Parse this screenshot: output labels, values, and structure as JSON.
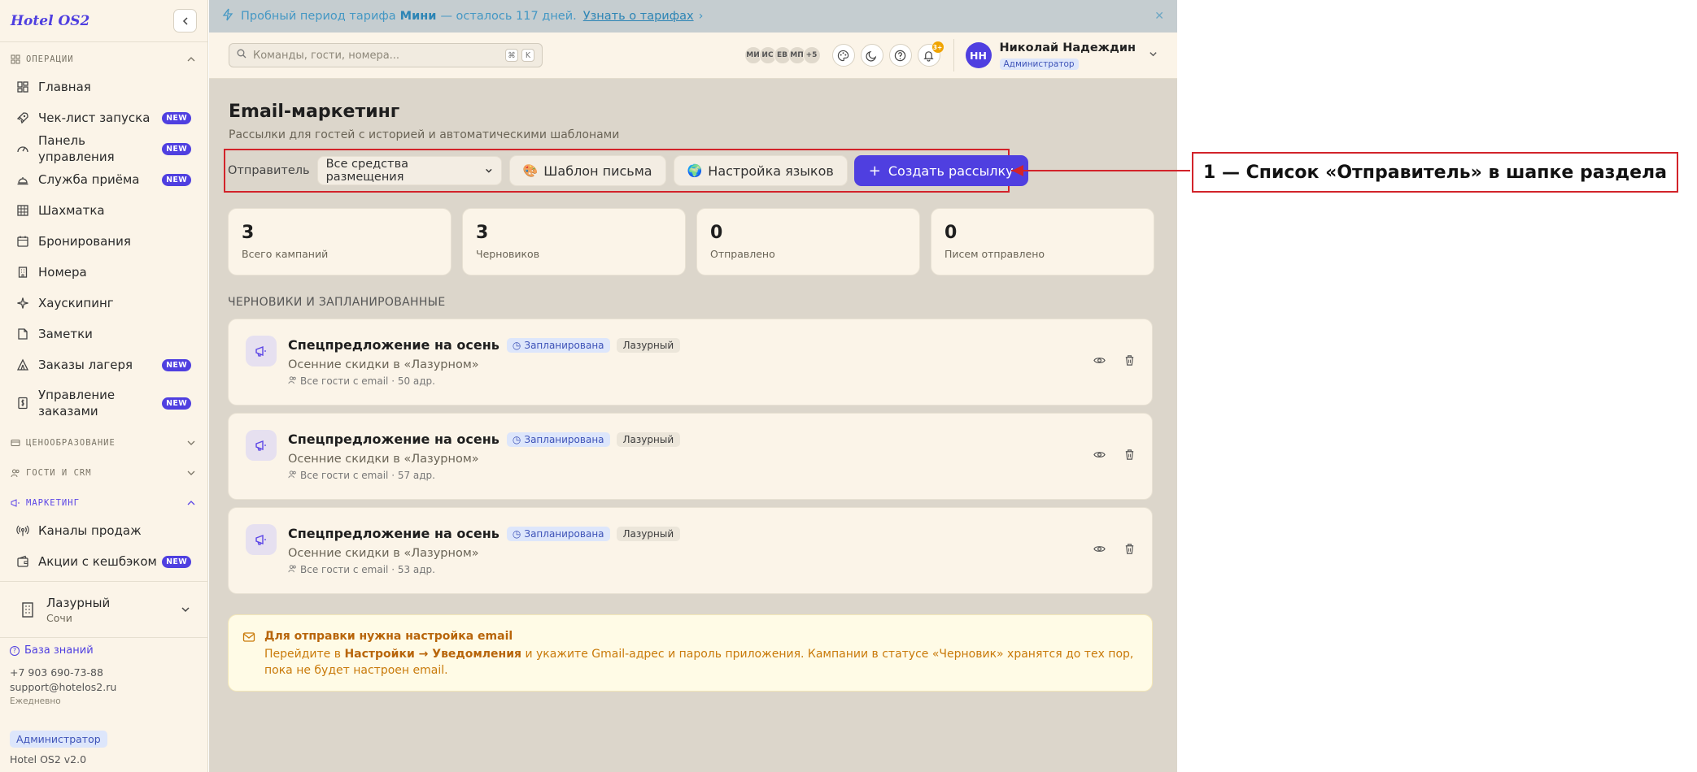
{
  "sidebar": {
    "logo": "Hotel OS2",
    "sections": {
      "operations": "ОПЕРАЦИИ",
      "pricing": "ЦЕНООБРАЗОВАНИЕ",
      "guests": "ГОСТИ И CRM",
      "marketing": "МАРКЕТИНГ"
    },
    "items": [
      {
        "label": "Главная",
        "icon": "dashboard-icon",
        "new": false
      },
      {
        "label": "Чек-лист запуска",
        "icon": "rocket-icon",
        "new": true
      },
      {
        "label": "Панель управления",
        "icon": "gauge-icon",
        "new": true
      },
      {
        "label": "Служба приёма",
        "icon": "bell-desk-icon",
        "new": true
      },
      {
        "label": "Шахматка",
        "icon": "grid-icon",
        "new": false
      },
      {
        "label": "Бронирования",
        "icon": "calendar-icon",
        "new": false
      },
      {
        "label": "Номера",
        "icon": "building-icon",
        "new": false
      },
      {
        "label": "Хаускипинг",
        "icon": "sparkle-icon",
        "new": false
      },
      {
        "label": "Заметки",
        "icon": "note-icon",
        "new": false
      },
      {
        "label": "Заказы лагеря",
        "icon": "tent-icon",
        "new": true
      },
      {
        "label": "Управление заказами",
        "icon": "receipt-icon",
        "new": true
      }
    ],
    "marketing_items": [
      {
        "label": "Каналы продаж",
        "icon": "broadcast-icon",
        "new": false
      },
      {
        "label": "Акции с кешбэком",
        "icon": "wallet-icon",
        "new": true
      }
    ],
    "new_badge": "NEW",
    "hotel": {
      "name": "Лазурный",
      "city": "Сочи"
    },
    "footer": {
      "knowledge_base": "База знаний",
      "phone": "+7 903 690-73-88",
      "email": "support@hotelos2.ru",
      "schedule": "Ежедневно",
      "role": "Администратор",
      "version": "Hotel OS2 v2.0"
    }
  },
  "banner": {
    "prefix": "Пробный период тарифа",
    "plan": "Мини",
    "suffix": "— осталось 117 дней.",
    "link": "Узнать о тарифах"
  },
  "topbar": {
    "search_placeholder": "Команды, гости, номера...",
    "kbd1": "⌘",
    "kbd2": "K",
    "avatars": [
      "МИ",
      "ИС",
      "ЕВ",
      "МП",
      "+5"
    ],
    "notif_count": "3+",
    "user": {
      "initials": "НН",
      "name": "Николай Надеждин",
      "role": "Администратор"
    }
  },
  "page": {
    "title": "Email-маркетинг",
    "subtitle": "Рассылки для гостей с историей и автоматическими шаблонами",
    "sender_label": "Отправитель",
    "sender_value": "Все средства размещения",
    "template_btn": "Шаблон письма",
    "lang_btn": "Настройка языков",
    "create_btn": "Создать рассылку"
  },
  "stats": [
    {
      "value": "3",
      "label": "Всего кампаний"
    },
    {
      "value": "3",
      "label": "Черновиков"
    },
    {
      "value": "0",
      "label": "Отправлено"
    },
    {
      "value": "0",
      "label": "Писем отправлено"
    }
  ],
  "drafts_heading": "ЧЕРНОВИКИ И ЗАПЛАНИРОВАННЫЕ",
  "campaigns": [
    {
      "title": "Спецпредложение на осень",
      "status": "Запланирована",
      "hotel": "Лазурный",
      "subtitle": "Осенние скидки в «Лазурном»",
      "meta": "Все гости с email · 50 адр."
    },
    {
      "title": "Спецпредложение на осень",
      "status": "Запланирована",
      "hotel": "Лазурный",
      "subtitle": "Осенние скидки в «Лазурном»",
      "meta": "Все гости с email · 57 адр."
    },
    {
      "title": "Спецпредложение на осень",
      "status": "Запланирована",
      "hotel": "Лазурный",
      "subtitle": "Осенние скидки в «Лазурном»",
      "meta": "Все гости с email · 53 адр."
    }
  ],
  "warning": {
    "title": "Для отправки нужна настройка email",
    "p1": "Перейдите в",
    "link": "Настройки → Уведомления",
    "p2": "и укажите Gmail-адрес и пароль приложения. Кампании в статусе «Черновик» хранятся до тех пор, пока не будет настроен email."
  },
  "callout": "1 — Список «Отправитель» в шапке раздела",
  "colors": {
    "accent": "#4f3fe0",
    "annotation": "#d2232a"
  }
}
